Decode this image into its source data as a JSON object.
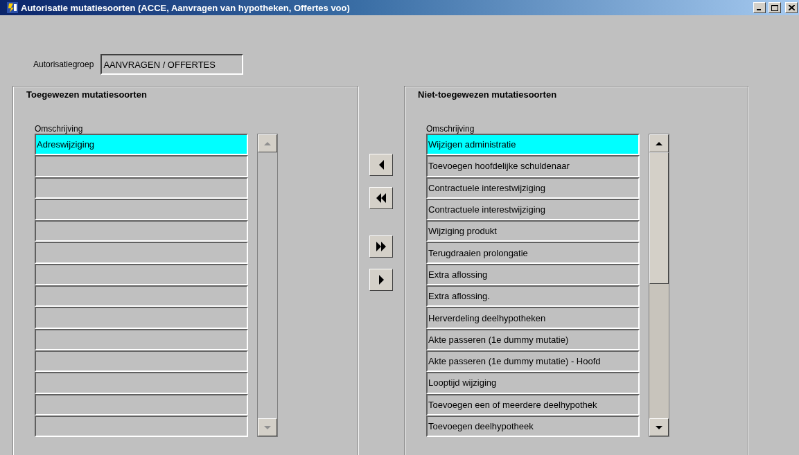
{
  "window": {
    "title": "Autorisatie mutatiesoorten (ACCE, Aanvragen van hypotheken, Offertes voo)"
  },
  "group_field": {
    "label": "Autorisatiegroep",
    "value": "AANVRAGEN / OFFERTES"
  },
  "assigned": {
    "title": "Toegewezen mutatiesoorten",
    "column": "Omschrijving",
    "scroll_disabled": true,
    "rows": [
      {
        "text": "Adreswijziging",
        "selected": true
      }
    ]
  },
  "transfer_buttons": [
    {
      "kind": "left"
    },
    {
      "kind": "all-left"
    },
    {
      "kind": "all-right"
    },
    {
      "kind": "right"
    }
  ],
  "unassigned": {
    "title": "Niet-toegewezen mutatiesoorten",
    "column": "Omschrijving",
    "scroll_disabled": false,
    "rows": [
      {
        "text": "Wijzigen administratie",
        "selected": true
      },
      {
        "text": "Toevoegen hoofdelijke schuldenaar",
        "selected": false
      },
      {
        "text": "Contractuele interestwijziging",
        "selected": false
      },
      {
        "text": "Contractuele interestwijziging",
        "selected": false
      },
      {
        "text": "Wijziging produkt",
        "selected": false
      },
      {
        "text": "Terugdraaien prolongatie",
        "selected": false
      },
      {
        "text": "Extra aflossing",
        "selected": false
      },
      {
        "text": "Extra aflossing.",
        "selected": false
      },
      {
        "text": "Herverdeling deelhypotheken",
        "selected": false
      },
      {
        "text": "Akte passeren (1e dummy mutatie)",
        "selected": false
      },
      {
        "text": "Akte passeren (1e dummy mutatie) - Hoofd",
        "selected": false
      },
      {
        "text": "Looptijd wijziging",
        "selected": false
      },
      {
        "text": "Toevoegen een of meerdere deelhypothek",
        "selected": false
      },
      {
        "text": "Toevoegen deelhypotheek",
        "selected": false
      }
    ]
  }
}
